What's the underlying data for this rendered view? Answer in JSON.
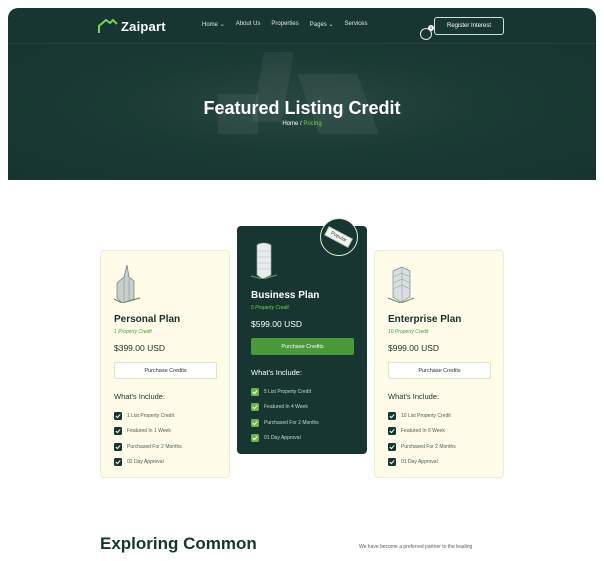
{
  "brand": {
    "name": "Zaipart"
  },
  "nav": {
    "items": [
      "Home",
      "About Us",
      "Properties",
      "Pages",
      "Services"
    ],
    "register_label": "Register Interest",
    "cart_count": "0"
  },
  "hero": {
    "title": "Featured Listing Credit",
    "breadcrumb_home": "Home",
    "breadcrumb_sep": " / ",
    "breadcrumb_current": "Pricing"
  },
  "plans": [
    {
      "name": "Personal Plan",
      "credit": "1 Property Credit",
      "price": "$399.00 USD",
      "button": "Purchase Credits",
      "include_title": "What's Include:",
      "features": [
        "1 List Property Credit",
        "Featured In 1 Week",
        "Purchased For 2 Months",
        "02 Day Approval"
      ]
    },
    {
      "name": "Business Plan",
      "credit": "5 Property Credit",
      "price": "$599.00 USD",
      "button": "Purchase Credits",
      "include_title": "What's Include:",
      "badge": "Popular",
      "features": [
        "5 List Property Credit",
        "Featured In 4 Week",
        "Purchased For 2 Months",
        "01 Day Approval"
      ]
    },
    {
      "name": "Enterprise Plan",
      "credit": "10 Property Credit",
      "price": "$999.00 USD",
      "button": "Purchase Credits",
      "include_title": "What's Include:",
      "features": [
        "10 List Property Credit",
        "Featured In 6 Week",
        "Purchased For 2 Months",
        "01 Day Approval"
      ]
    }
  ],
  "explore": {
    "title": "Exploring Common",
    "text": "We have become a preferred partner to the leading"
  },
  "colors": {
    "primary": "#173631",
    "accent": "#4a9a3a",
    "card_bg": "#fffde9"
  },
  "icons": [
    "logo-house-icon",
    "chevron-down-icon",
    "cart-icon",
    "building-icon",
    "check-icon"
  ]
}
